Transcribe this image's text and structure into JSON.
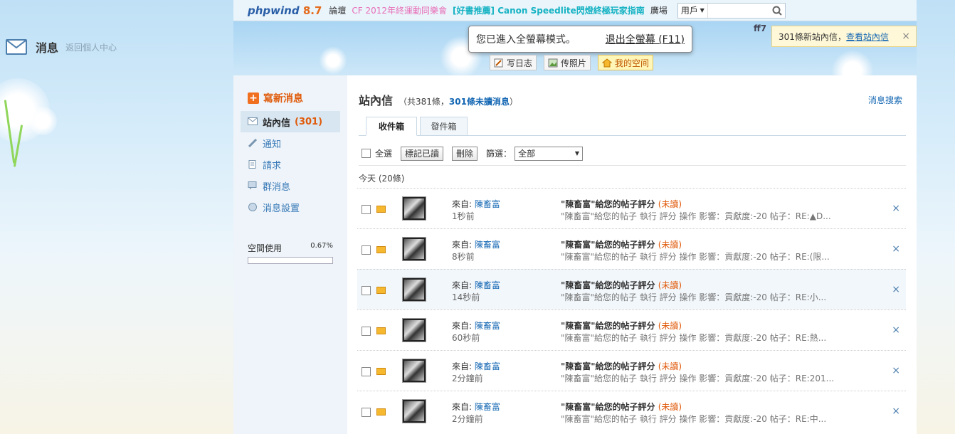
{
  "topnav": {
    "logo": "phpwind",
    "version": "8.7",
    "links": {
      "forum": "論壇",
      "promo1": "CF 2012年終運動同樂會",
      "promo2": "[好書推薦] Canon Speedlite閃燈終極玩家指南",
      "plaza": "廣場"
    },
    "search_scope": "用戶"
  },
  "header": {
    "title": "消息",
    "back_link": "返回個人中心",
    "user": "ff7"
  },
  "fullscreen_toast": {
    "message": "您已進入全螢幕模式。",
    "exit_label": "退出全螢幕 (F11)"
  },
  "notification": {
    "text": "301條新站內信，",
    "link": "查看站內信"
  },
  "quick_buttons": [
    {
      "label": "写日志"
    },
    {
      "label": "传照片"
    },
    {
      "label": "我的空间"
    }
  ],
  "sidebar": {
    "compose_label": "寫新消息",
    "items": [
      {
        "label": "站內信",
        "count": "(301)"
      },
      {
        "label": "通知"
      },
      {
        "label": "請求"
      },
      {
        "label": "群消息"
      },
      {
        "label": "消息設置"
      }
    ],
    "space_label": "空間使用",
    "space_percent": "0.67%"
  },
  "main": {
    "title": "站內信",
    "summary_pre": "（共381條，",
    "summary_unread": "301條未讀消息",
    "summary_post": "）",
    "search_link": "消息搜索",
    "tabs": [
      {
        "label": "收件箱"
      },
      {
        "label": "發件箱"
      }
    ],
    "toolbar": {
      "select_all": "全選",
      "mark_read": "標記已讀",
      "delete": "刪除",
      "filter_label": "篩選：",
      "filter_value": "全部"
    },
    "day_label": "今天 (20條)",
    "messages": [
      {
        "from_label": "來自:",
        "from": "陳畜富",
        "time": "1秒前",
        "subject": "\"陳畜富\"給您的帖子評分",
        "status": "(未讀)",
        "preview": "\"陳畜富\"給您的帖子 執行 評分 操作 影響：貢獻度:-20 帖子：RE:▲D..."
      },
      {
        "from_label": "來自:",
        "from": "陳畜富",
        "time": "8秒前",
        "subject": "\"陳畜富\"給您的帖子評分",
        "status": "(未讀)",
        "preview": "\"陳畜富\"給您的帖子 執行 評分 操作 影響：貢獻度:-20 帖子：RE:(限..."
      },
      {
        "from_label": "來自:",
        "from": "陳畜富",
        "time": "14秒前",
        "subject": "\"陳畜富\"給您的帖子評分",
        "status": "(未讀)",
        "preview": "\"陳畜富\"給您的帖子 執行 評分 操作 影響：貢獻度:-20 帖子：RE:小..."
      },
      {
        "from_label": "來自:",
        "from": "陳畜富",
        "time": "60秒前",
        "subject": "\"陳畜富\"給您的帖子評分",
        "status": "(未讀)",
        "preview": "\"陳畜富\"給您的帖子 執行 評分 操作 影響：貢獻度:-20 帖子：RE:熱..."
      },
      {
        "from_label": "來自:",
        "from": "陳畜富",
        "time": "2分鐘前",
        "subject": "\"陳畜富\"給您的帖子評分",
        "status": "(未讀)",
        "preview": "\"陳畜富\"給您的帖子 執行 評分 操作 影響：貢獻度:-20 帖子：RE:201..."
      },
      {
        "from_label": "來自:",
        "from": "陳畜富",
        "time": "2分鐘前",
        "subject": "\"陳畜富\"給您的帖子評分",
        "status": "(未讀)",
        "preview": "\"陳畜富\"給您的帖子 執行 評分 操作 影響：貢獻度:-20 帖子：RE:中..."
      }
    ]
  },
  "colors": {
    "accent": "#e05a0a",
    "link": "#1467b3"
  }
}
